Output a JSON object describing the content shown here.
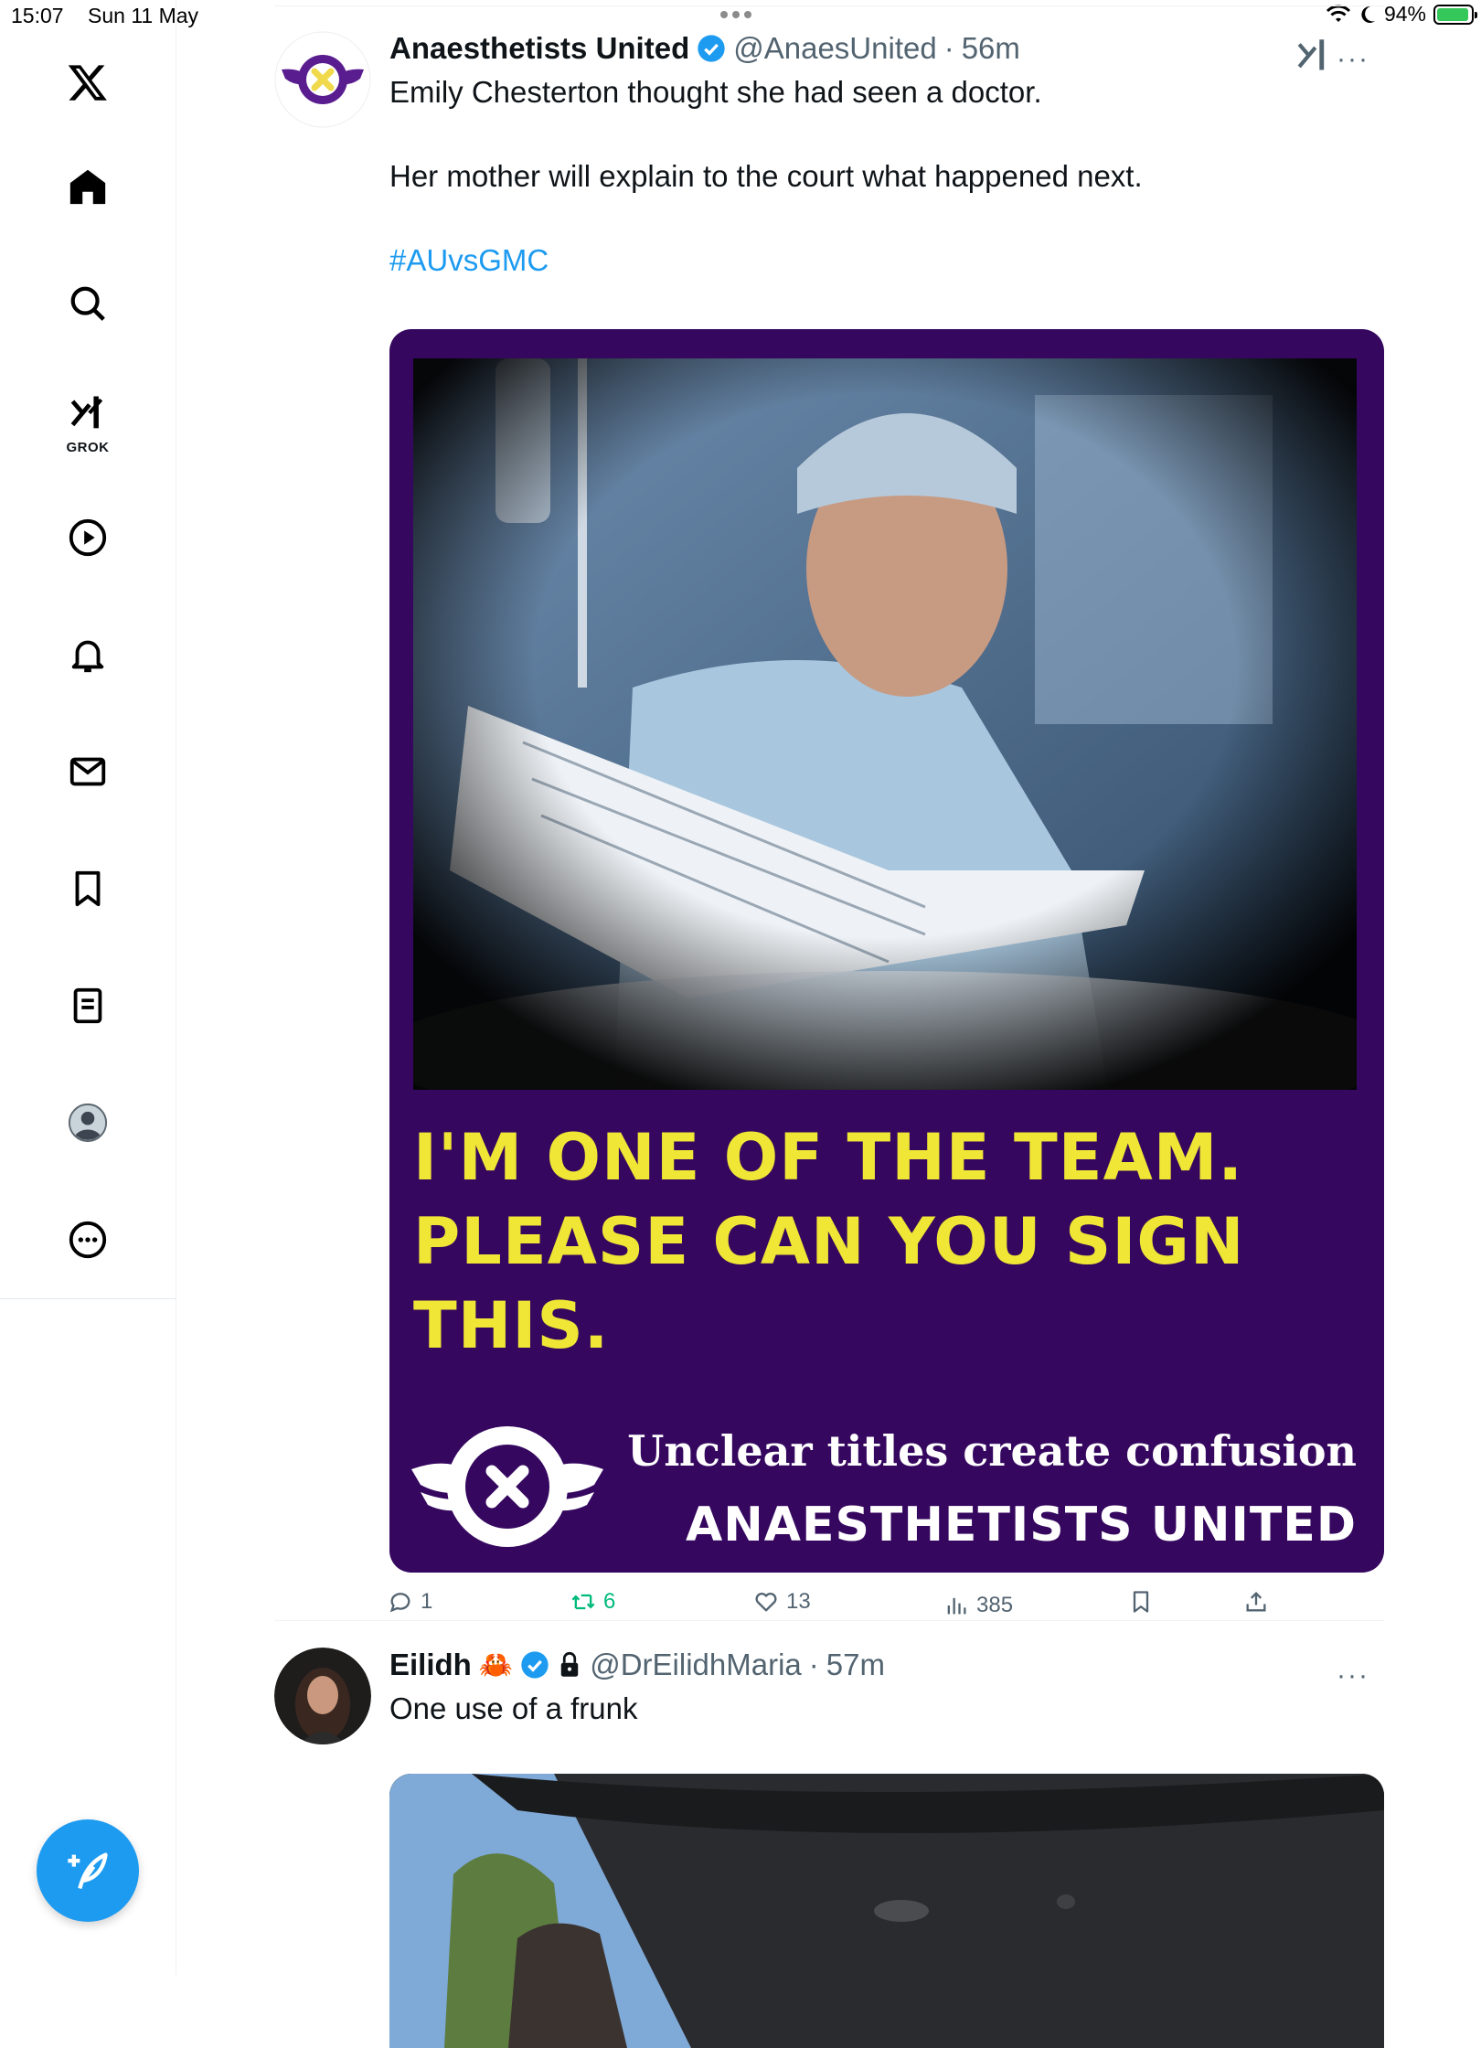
{
  "status_bar": {
    "time": "15:07",
    "date": "Sun 11 May",
    "battery": "94%",
    "battery_level": 0.94,
    "icons": [
      "wifi-icon",
      "moon-icon",
      "battery-charging-icon"
    ]
  },
  "sidebar": {
    "items": [
      {
        "name": "x-logo-icon"
      },
      {
        "name": "home-icon"
      },
      {
        "name": "search-icon"
      },
      {
        "name": "grok-icon",
        "label": "GROK"
      },
      {
        "name": "video-icon"
      },
      {
        "name": "notifications-icon"
      },
      {
        "name": "messages-icon"
      },
      {
        "name": "bookmarks-icon"
      },
      {
        "name": "lists-icon"
      },
      {
        "name": "profile-icon"
      },
      {
        "name": "more-icon"
      }
    ],
    "compose_icon": "compose-post-icon"
  },
  "tweets": [
    {
      "display_name": "Anaesthetists United",
      "handle": "@AnaesUnited",
      "time": "56m",
      "sep": "·",
      "text_line1": "Emily Chesterton thought she had seen a doctor.",
      "text_line2": "Her mother will explain to the court what happened next.",
      "hashtag": "#AUvsGMC",
      "more": "···",
      "poster": {
        "line1": "I'M ONE OF THE TEAM.",
        "line2": "PLEASE CAN YOU SIGN THIS.",
        "tagline": "Unclear titles create confusion",
        "org": "ANAESTHETISTS UNITED",
        "colors": {
          "background": "#35075f",
          "headline": "#f0e635",
          "text": "#ffffff"
        }
      },
      "stats": {
        "replies": "1",
        "reposts": "6",
        "likes": "13",
        "views": "385"
      }
    },
    {
      "display_name": "Eilidh",
      "handle": "@DrEilidhMaria",
      "time": "57m",
      "sep": "·",
      "emoji": "🦀",
      "text": "One use of a frunk",
      "more": "···"
    }
  ],
  "colors": {
    "accent": "#1d9bf0",
    "secondary_text": "#536471",
    "repost_green": "#00ba7c"
  }
}
